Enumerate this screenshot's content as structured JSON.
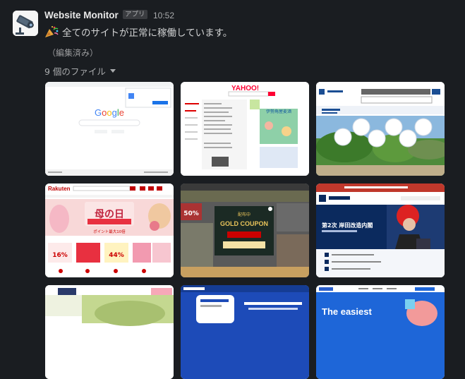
{
  "message": {
    "sender": "Website Monitor",
    "app_badge": "アプリ",
    "time": "10:52",
    "status_text": "全てのサイトが正常に稼働しています。",
    "edited_label": "（編集済み）",
    "files_label": "9 個のファイル"
  },
  "thumbnails": {
    "google": {
      "logo": "Google"
    },
    "yahoo": {
      "logo": "YAHOO!",
      "banner": "伊勢角屋麦酒"
    },
    "rakuten": {
      "logo": "Rakuten",
      "banner": "母の日",
      "promo": "ポイント最大10倍",
      "price1": "16%",
      "price2": "44%"
    },
    "gold": {
      "title": "GOLD COUPON",
      "badge": "配布中",
      "sale": "50%"
    },
    "kantei": {
      "headline": "第2次 岸田改造内閣"
    },
    "stripe": {
      "text": "The easiest"
    }
  },
  "colors": {
    "background": "#1a1d21",
    "rakuten_red": "#bf0000",
    "kantei_navy": "#0b2a5e"
  }
}
